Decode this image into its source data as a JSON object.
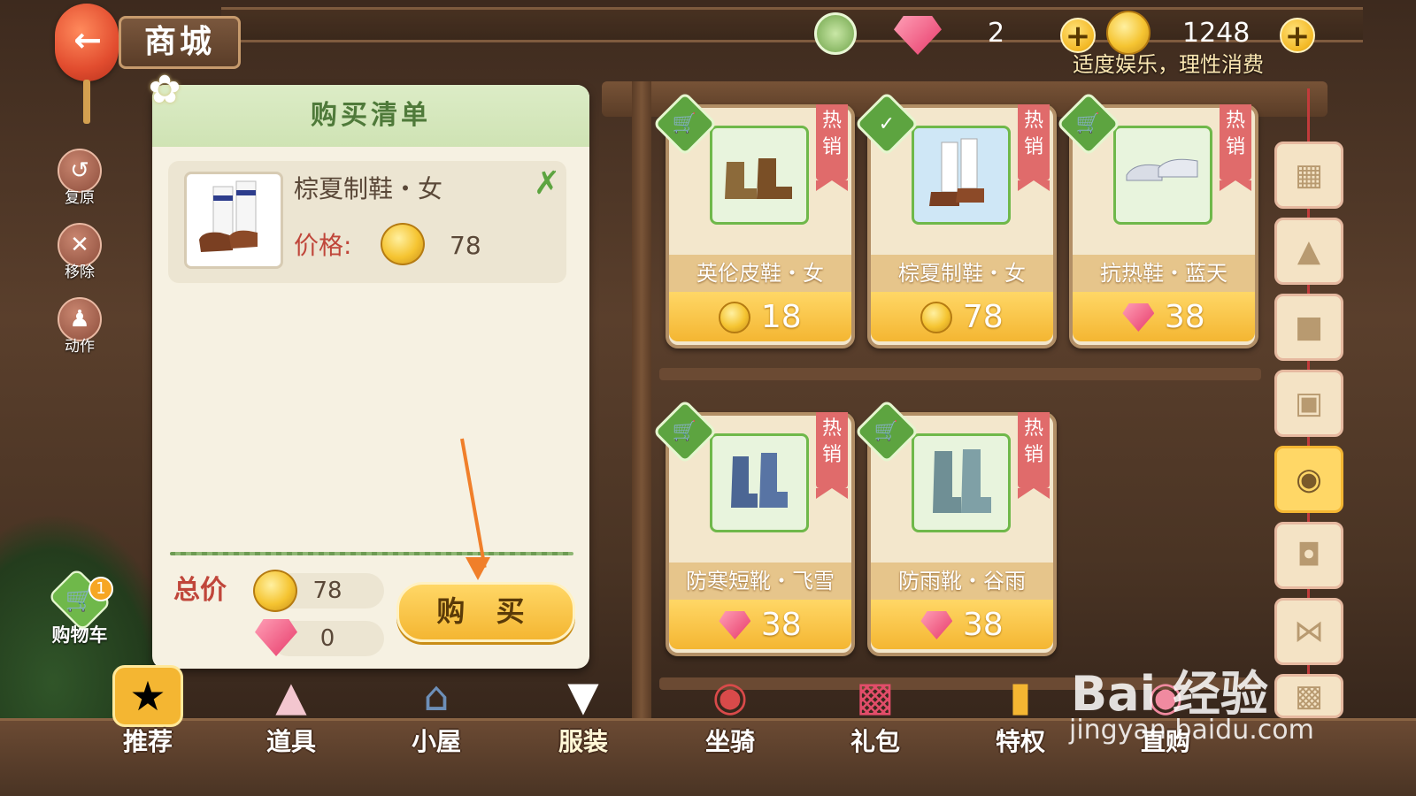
{
  "header": {
    "title": "商城",
    "gem_count": "2",
    "coin_count": "1248",
    "notice": "适度娱乐，理性消费"
  },
  "side_actions": [
    {
      "label": "复原"
    },
    {
      "label": "移除"
    },
    {
      "label": "动作"
    }
  ],
  "cart": {
    "label": "购物车",
    "badge": "1"
  },
  "purchase_list": {
    "title": "购买清单",
    "item": {
      "name": "棕夏制鞋・女",
      "price_label": "价格:",
      "price": "78"
    },
    "total_label": "总价",
    "total_coins": "78",
    "total_gems": "0",
    "buy_label": "购 买"
  },
  "hot_label": "热销",
  "products": [
    {
      "name": "英伦皮鞋・女",
      "price": "18",
      "currency": "coin",
      "status": "cart",
      "icon": "brown-boots-icon"
    },
    {
      "name": "棕夏制鞋・女",
      "price": "78",
      "currency": "coin",
      "status": "selected",
      "icon": "loafers-socks-icon"
    },
    {
      "name": "抗热鞋・蓝天",
      "price": "38",
      "currency": "gem",
      "status": "cart",
      "icon": "white-shoes-icon"
    },
    {
      "name": "防寒短靴・飞雪",
      "price": "38",
      "currency": "gem",
      "status": "cart",
      "icon": "blue-boots-icon"
    },
    {
      "name": "防雨靴・谷雨",
      "price": "38",
      "currency": "gem",
      "status": "cart",
      "icon": "rain-boots-icon"
    }
  ],
  "categories": [
    "all",
    "dress",
    "shirt",
    "pants",
    "shoes",
    "hat",
    "bow",
    "bag"
  ],
  "bottom_nav": [
    {
      "label": "推荐"
    },
    {
      "label": "道具"
    },
    {
      "label": "小屋"
    },
    {
      "label": "服装"
    },
    {
      "label": "坐骑"
    },
    {
      "label": "礼包"
    },
    {
      "label": "特权"
    },
    {
      "label": "直购"
    }
  ],
  "watermark": {
    "line1": "Bai 经验",
    "line2": "jingyan.baidu.com"
  },
  "colors": {
    "accent_green": "#5da440",
    "accent_gold": "#f4b632",
    "price_red": "#c0463a"
  }
}
